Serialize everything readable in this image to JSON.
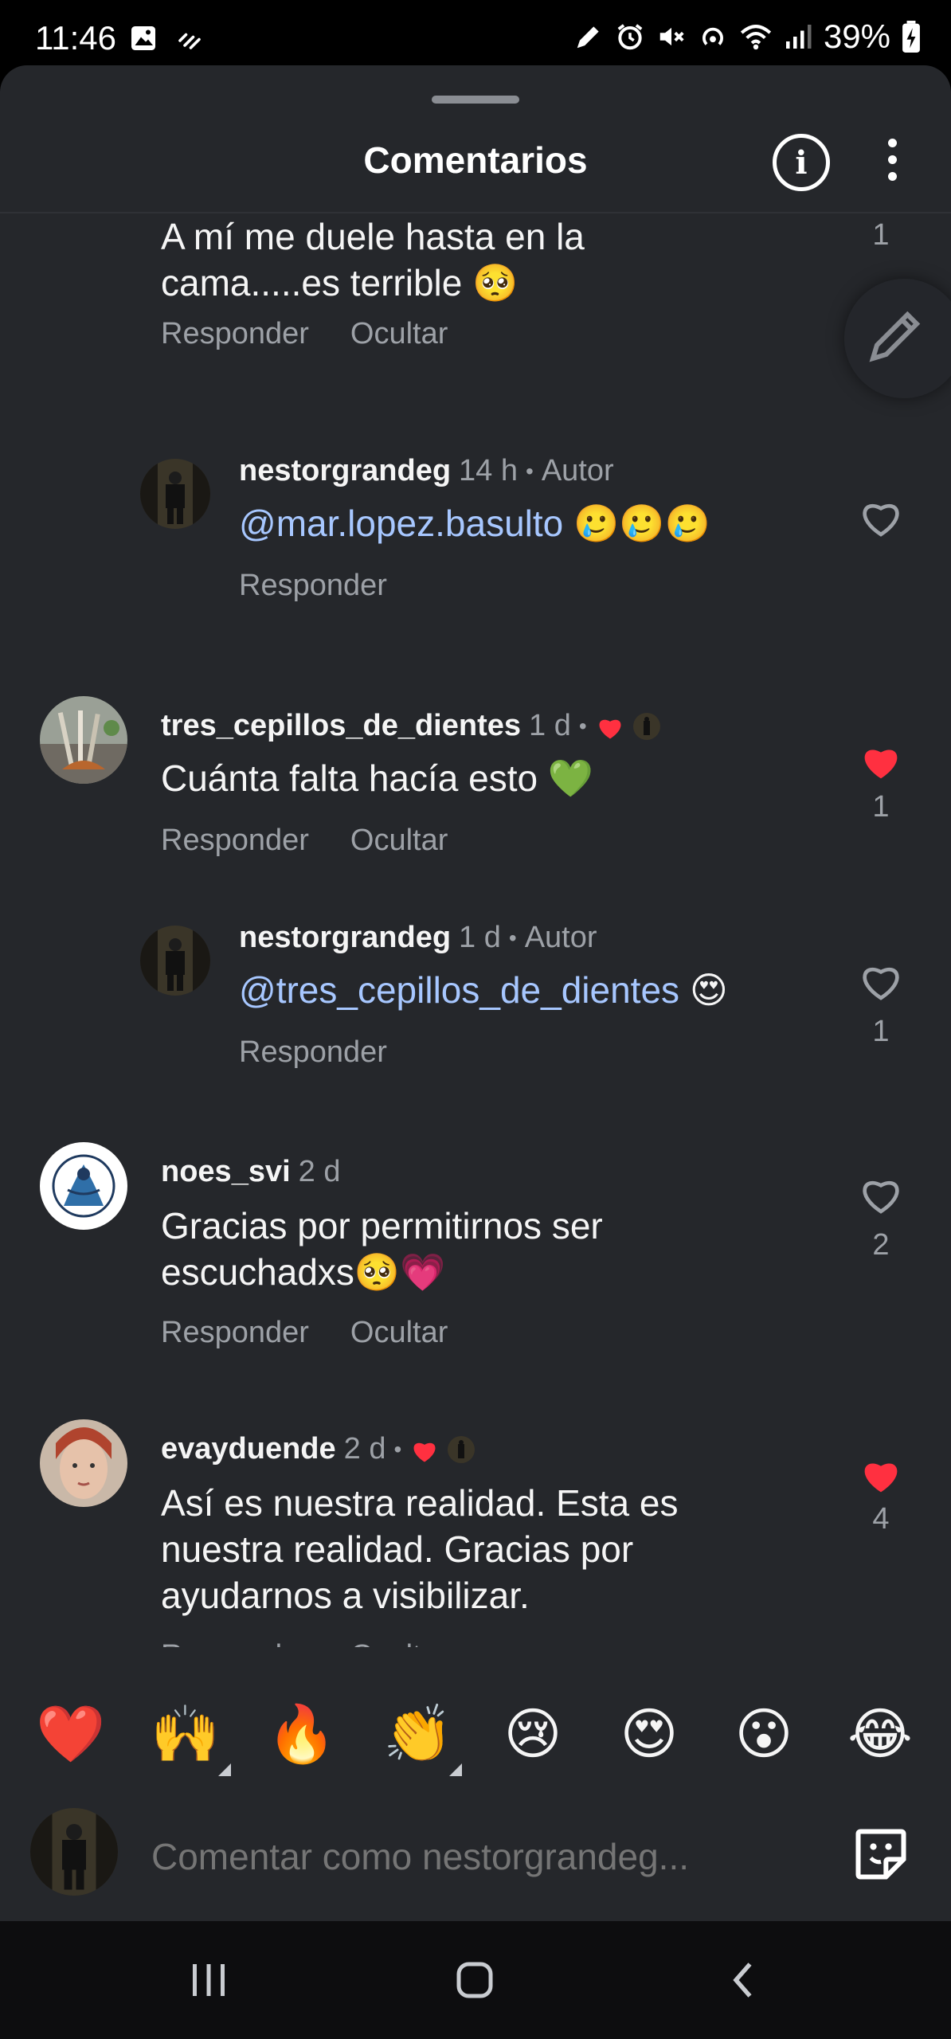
{
  "status_bar": {
    "time": "11:46",
    "battery": "39%"
  },
  "header": {
    "title": "Comentarios",
    "info_label": "i"
  },
  "comments": [
    {
      "text_line1": "A mí me duele hasta en la",
      "text_line2": "cama.....es terrible",
      "emoji": "🥺",
      "like_count": "1",
      "reply_label": "Responder",
      "hide_label": "Ocultar"
    },
    {
      "username": "nestorgrandeg",
      "time": "14 h",
      "sep": "•",
      "author_label": "Autor",
      "mention": "@mar.lopez.basulto",
      "emoji": "🥲🥲🥲",
      "reply_label": "Responder"
    },
    {
      "username": "tres_cepillos_de_dientes",
      "time": "1 d",
      "sep": "•",
      "text": "Cuánta falta hacía esto",
      "emoji": "💚",
      "like_count": "1",
      "reply_label": "Responder",
      "hide_label": "Ocultar"
    },
    {
      "username": "nestorgrandeg",
      "time": "1 d",
      "sep": "•",
      "author_label": "Autor",
      "mention": "@tres_cepillos_de_dientes",
      "emoji": "😍",
      "like_count": "1",
      "reply_label": "Responder"
    },
    {
      "username": "noes_svi",
      "time": "2 d",
      "text_line1": "Gracias por permitirnos ser",
      "text_line2": "escuchadxs",
      "emoji": "🥺💗",
      "like_count": "2",
      "reply_label": "Responder",
      "hide_label": "Ocultar"
    },
    {
      "username": "evayduende",
      "time": "2 d",
      "sep": "•",
      "text_line1": "Así es nuestra realidad. Esta es",
      "text_line2": "nuestra realidad. Gracias por",
      "text_line3": "ayudarnos a visibilizar.",
      "like_count": "4",
      "reply_label": "Responder",
      "hide_label": "Ocultar"
    }
  ],
  "emoji_bar": [
    "❤️",
    "🙌",
    "🔥",
    "👏",
    "😢",
    "😍",
    "😮",
    "😂"
  ],
  "input": {
    "placeholder": "Comentar como nestorgrandeg..."
  },
  "colors": {
    "sheet_bg": "#25272b",
    "like_red": "#ff3040",
    "mention": "#a7c7ff",
    "muted": "#9da1a7"
  }
}
